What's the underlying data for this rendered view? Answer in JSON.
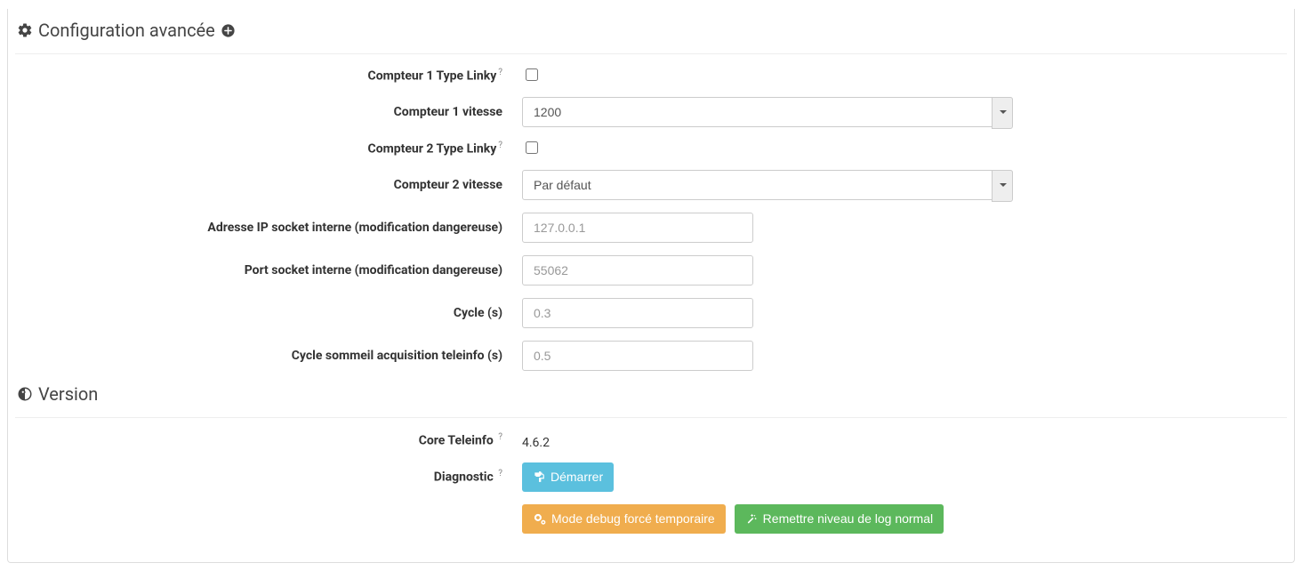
{
  "section_config": {
    "title": "Configuration avancée"
  },
  "fields": {
    "compteur1_linky_label": "Compteur 1 Type Linky",
    "compteur1_linky_checked": false,
    "compteur1_vitesse_label": "Compteur 1 vitesse",
    "compteur1_vitesse_value": "1200",
    "compteur2_linky_label": "Compteur 2 Type Linky",
    "compteur2_linky_checked": false,
    "compteur2_vitesse_label": "Compteur 2 vitesse",
    "compteur2_vitesse_value": "Par défaut",
    "ip_label": "Adresse IP socket interne (modification dangereuse)",
    "ip_placeholder": "127.0.0.1",
    "ip_value": "",
    "port_label": "Port socket interne (modification dangereuse)",
    "port_placeholder": "55062",
    "port_value": "",
    "cycle_label": "Cycle (s)",
    "cycle_placeholder": "0.3",
    "cycle_value": "",
    "cycle_sommeil_label": "Cycle sommeil acquisition teleinfo (s)",
    "cycle_sommeil_placeholder": "0.5",
    "cycle_sommeil_value": ""
  },
  "section_version": {
    "title": "Version"
  },
  "version": {
    "core_label": "Core Teleinfo",
    "core_value": "4.6.2",
    "diagnostic_label": "Diagnostic",
    "start_button": "Démarrer",
    "debug_button": "Mode debug forcé temporaire",
    "normal_button": "Remettre niveau de log normal"
  },
  "vitesse_options": [
    "1200",
    "Par défaut"
  ]
}
